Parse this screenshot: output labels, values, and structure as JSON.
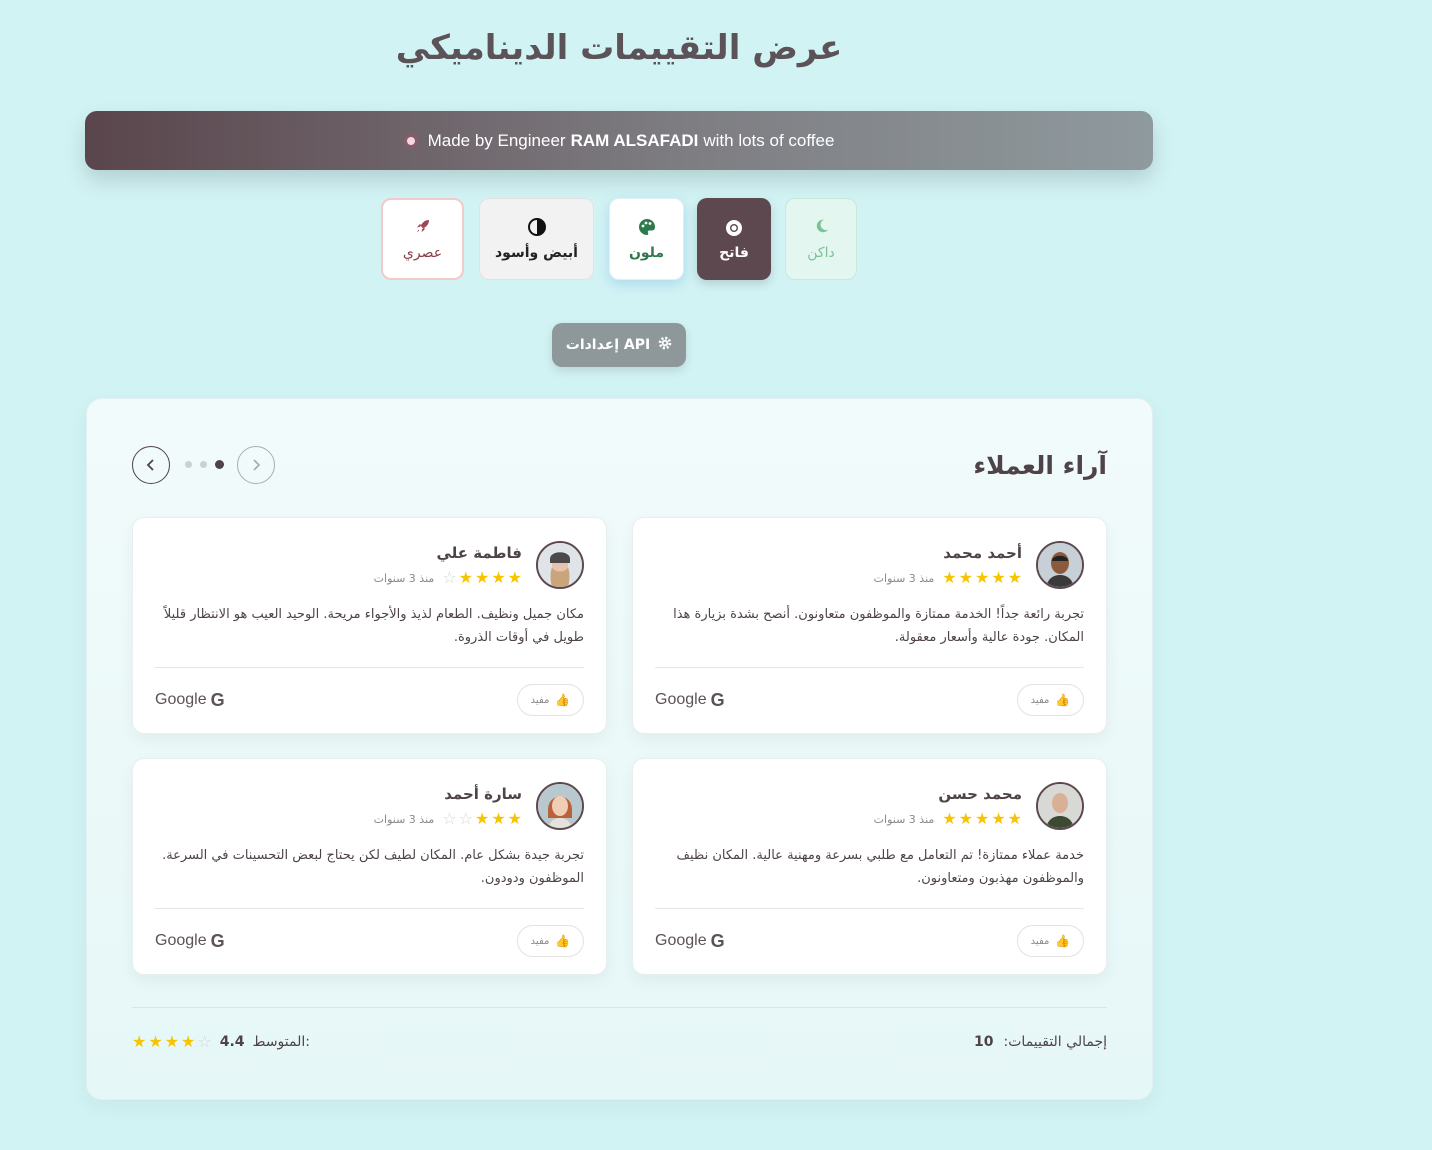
{
  "header": {
    "title": "عرض التقييمات الديناميكي"
  },
  "credit": {
    "prefix": "Made by Engineer",
    "name": "RAM ALSAFADI",
    "suffix": "with lots of coffee"
  },
  "themes": {
    "dark": "داكن",
    "light": "فاتح",
    "colorful": "ملون",
    "bw": "أبيض وأسود",
    "modern": "عصري"
  },
  "api_button": {
    "label": "إعدادات API"
  },
  "reviews_section": {
    "title": "آراء العملاء",
    "reviews": [
      {
        "name": "أحمد محمد",
        "time": "منذ 3 سنوات",
        "rating": 5,
        "text": "تجربة رائعة جداً! الخدمة ممتازة والموظفون متعاونون. أنصح بشدة بزيارة هذا المكان. جودة عالية وأسعار معقولة.",
        "source": "Google",
        "helpful": "مفيد"
      },
      {
        "name": "فاطمة علي",
        "time": "منذ 3 سنوات",
        "rating": 4,
        "text": "مكان جميل ونظيف. الطعام لذيذ والأجواء مريحة. الوحيد العيب هو الانتظار قليلاً طويل في أوقات الذروة.",
        "source": "Google",
        "helpful": "مفيد"
      },
      {
        "name": "محمد حسن",
        "time": "منذ 3 سنوات",
        "rating": 5,
        "text": "خدمة عملاء ممتازة! تم التعامل مع طلبي بسرعة ومهنية عالية. المكان نظيف والموظفون مهذبون ومتعاونون.",
        "source": "Google",
        "helpful": "مفيد"
      },
      {
        "name": "سارة أحمد",
        "time": "منذ 3 سنوات",
        "rating": 3,
        "text": "تجربة جيدة بشكل عام. المكان لطيف لكن يحتاج لبعض التحسينات في السرعة. الموظفون ودودون.",
        "source": "Google",
        "helpful": "مفيد"
      }
    ],
    "pagination": {
      "pages": 3,
      "active": 3
    }
  },
  "summary": {
    "total_label": "إجمالي التقييمات:",
    "total_value": "10",
    "avg_label": "المتوسط:",
    "avg_value": "4.4",
    "avg_stars": 4
  },
  "colors": {
    "page_bg": "#d2f3f4",
    "accent": "#5d484f",
    "star": "#f6c500"
  }
}
